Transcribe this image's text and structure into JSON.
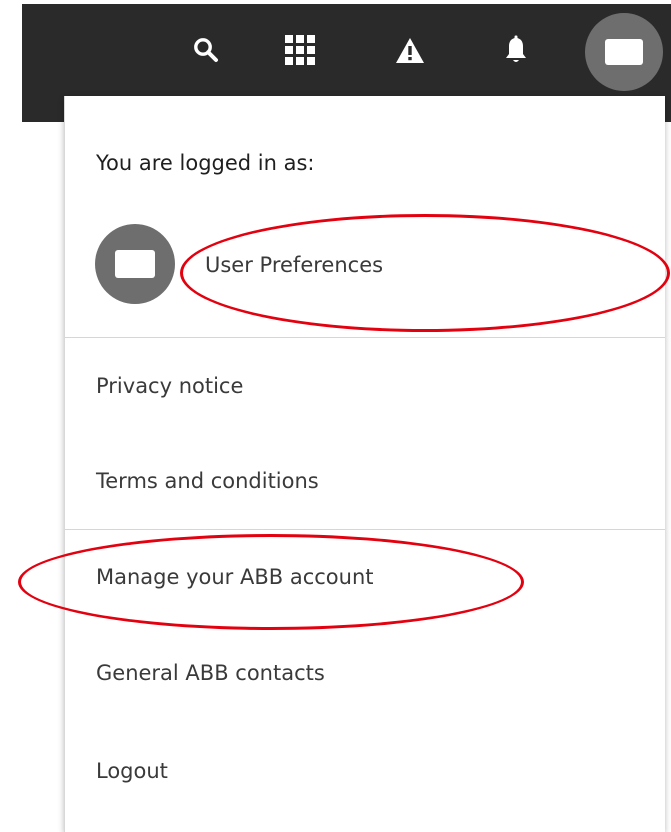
{
  "colors": {
    "topbar": "#2a2a2a",
    "avatar": "#6e6e6e",
    "annotation": "#e3000f",
    "text_primary": "#1f1f1f",
    "text_secondary": "#3a3a3a"
  },
  "topbar": {
    "icons": [
      "search-icon",
      "apps-grid-icon",
      "alert-icon",
      "bell-icon",
      "user-avatar-icon"
    ]
  },
  "user_menu": {
    "header": "You are logged in as:",
    "user_preferences": "User Preferences",
    "items": [
      "Privacy notice",
      "Terms and conditions",
      "Manage your ABB account",
      "General ABB contacts",
      "Logout"
    ]
  }
}
